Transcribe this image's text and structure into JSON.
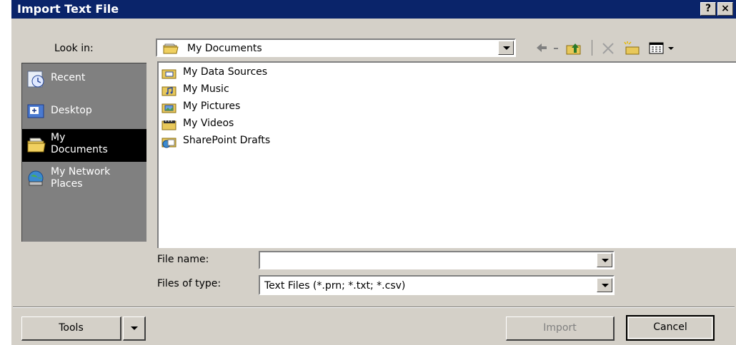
{
  "background_text": "...Import Text File ... Data Sources ... Text File dialog ...",
  "dialog": {
    "title": "Import Text File",
    "help_label": "?",
    "close_label": "×"
  },
  "lookin": {
    "label": "Look in:",
    "value": "My Documents"
  },
  "places": [
    {
      "label": "Recent",
      "icon": "recent-icon"
    },
    {
      "label": "Desktop",
      "icon": "desktop-icon"
    },
    {
      "label": "My\nDocuments",
      "icon": "my-documents-icon",
      "selected": true
    },
    {
      "label": "My Network\nPlaces",
      "icon": "network-places-icon"
    }
  ],
  "files": [
    {
      "label": "My Data Sources",
      "icon": "data-sources-icon"
    },
    {
      "label": "My Music",
      "icon": "music-folder-icon"
    },
    {
      "label": "My Pictures",
      "icon": "pictures-folder-icon"
    },
    {
      "label": "My Videos",
      "icon": "videos-folder-icon"
    },
    {
      "label": "SharePoint Drafts",
      "icon": "sharepoint-drafts-icon"
    }
  ],
  "filename": {
    "label": "File name:",
    "value": ""
  },
  "filetype": {
    "label": "Files of type:",
    "value": "Text Files (*.prn; *.txt; *.csv)"
  },
  "buttons": {
    "tools": "Tools",
    "import": "Import",
    "cancel": "Cancel"
  },
  "colors": {
    "title_bar": "#0a246a",
    "face": "#d4d0c8",
    "places_bg": "#808080",
    "selected": "#000000"
  }
}
